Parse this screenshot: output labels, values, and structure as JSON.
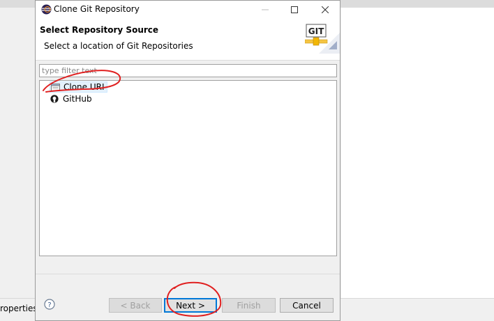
{
  "background": {
    "left_panel_label": "roperties"
  },
  "window": {
    "title": "Clone Git Repository",
    "controls": {
      "minimize": "—",
      "maximize": "☐",
      "close": "✕"
    }
  },
  "header": {
    "title": "Select Repository Source",
    "description": "Select a location of Git Repositories",
    "logo_text": "GIT"
  },
  "filter": {
    "value": "",
    "placeholder": "type filter text"
  },
  "sources": [
    {
      "label": "Clone URI",
      "icon": "clone-uri-icon",
      "selected": true
    },
    {
      "label": "GitHub",
      "icon": "github-icon",
      "selected": false
    }
  ],
  "buttons": {
    "help": "?",
    "back": "< Back",
    "next": "Next >",
    "finish": "Finish",
    "cancel": "Cancel"
  },
  "colors": {
    "annotation": "#e02020",
    "default_button_border": "#0078d7",
    "selection_bg": "#e5f1fb"
  }
}
